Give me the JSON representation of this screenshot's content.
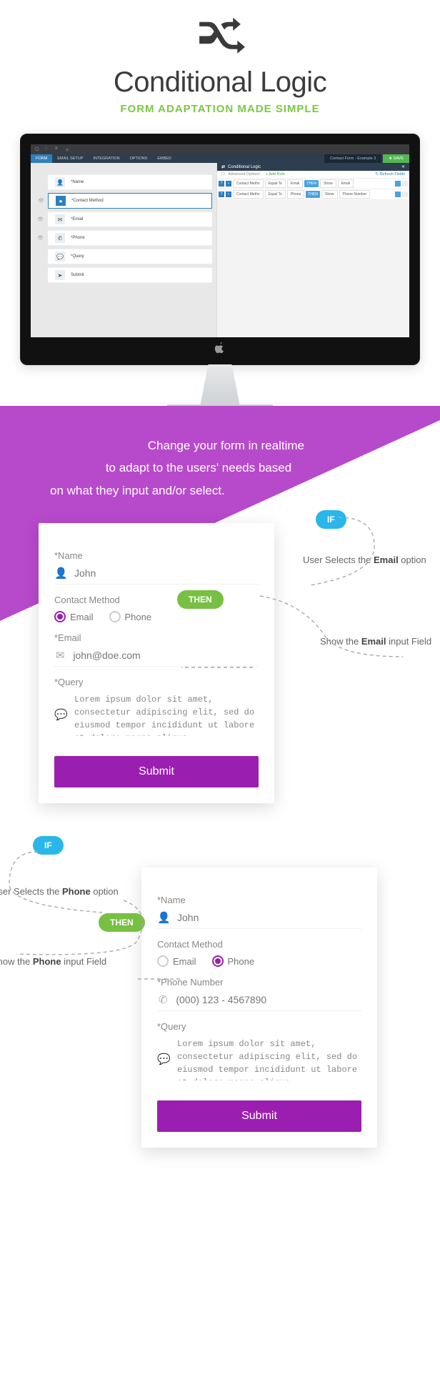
{
  "hero": {
    "title": "Conditional Logic",
    "subtitle": "FORM ADAPTATION MADE SIMPLE"
  },
  "toolbar": {
    "tabs": [
      "FORM",
      "EMAIL SETUP",
      "INTEGRATION",
      "OPTIONS",
      "EMBED"
    ],
    "crumb": "Contact Form - Example 3",
    "save": "SAVE",
    "fields": [
      {
        "icon": "👤",
        "label": "*Name"
      },
      {
        "icon": "●",
        "label": "*Contact Method"
      },
      {
        "icon": "✉",
        "label": "*Email"
      },
      {
        "icon": "✆",
        "label": "*Phone"
      },
      {
        "icon": "💬",
        "label": "*Query"
      },
      {
        "icon": "➤",
        "label": "Submit"
      }
    ]
  },
  "logicPanel": {
    "title": "Conditional Logic",
    "advanced": "Advanced Options",
    "addRule": "+ Add Rule",
    "refresh": "↻ Refresh Fields",
    "rules": [
      {
        "field": "Contact Metho",
        "op": "Equal To",
        "val": "Email",
        "then": "THEN",
        "act": "Show",
        "target": "Email"
      },
      {
        "field": "Contact Metho",
        "op": "Equal To",
        "val": "Phone",
        "then": "THEN",
        "act": "Show",
        "target": "Phone Number"
      }
    ]
  },
  "tagline": {
    "l1": "Change your form in realtime",
    "l2": "to adapt to the users' needs based",
    "l3": "on what they input and/or select."
  },
  "ex1": {
    "if": "IF",
    "then": "THEN",
    "note1_a": "User Selects the ",
    "note1_b": "Email",
    "note1_c": " option",
    "note2_a": "Show the ",
    "note2_b": "Email",
    "note2_c": " input Field",
    "name_l": "*Name",
    "name_v": "John",
    "cm_l": "Contact Method",
    "opt_email": "Email",
    "opt_phone": "Phone",
    "email_l": "*Email",
    "email_v": "john@doe.com",
    "q_l": "*Query",
    "q_v": "Lorem ipsum dolor sit amet, consectetur adipiscing elit, sed do eiusmod tempor incididunt ut labore et dolore magna aliqua",
    "submit": "Submit"
  },
  "ex2": {
    "if": "IF",
    "then": "THEN",
    "note1_a": "User Selects the ",
    "note1_b": "Phone",
    "note1_c": " option",
    "note2_a": "Show the ",
    "note2_b": "Phone",
    "note2_c": " input Field",
    "name_l": "*Name",
    "name_v": "John",
    "cm_l": "Contact Method",
    "opt_email": "Email",
    "opt_phone": "Phone",
    "phone_l": "*Phone Number",
    "phone_v": "(000) 123 - 4567890",
    "q_l": "*Query",
    "q_v": "Lorem ipsum dolor sit amet, consectetur adipiscing elit, sed do eiusmod tempor incididunt ut labore et dolore magna aliqua",
    "submit": "Submit"
  }
}
